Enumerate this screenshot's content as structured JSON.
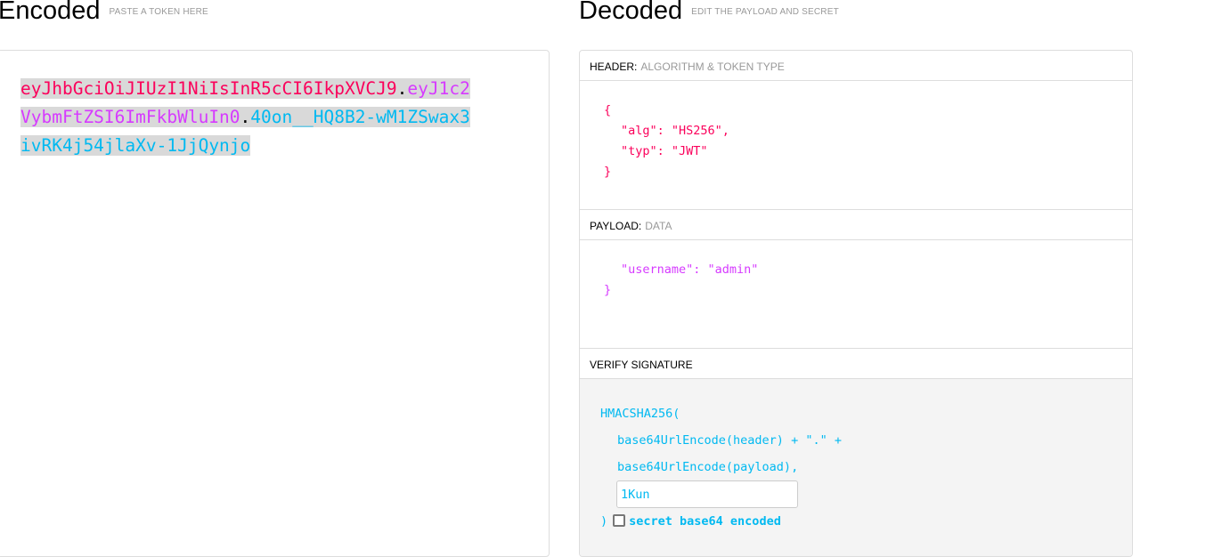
{
  "encoded": {
    "title": "Encoded",
    "subtitle": "PASTE A TOKEN HERE",
    "token": {
      "header": "eyJhbGciOiJIUzI1NiIsInR5cCI6IkpXVCJ9",
      "payload": "eyJ1c2VybmFtZSI6ImFkbWluIn0",
      "signature": "40on__HQ8B2-wM1ZSwax3ivRK4j54jlaXv-1JjQynjo",
      "dot": "."
    }
  },
  "decoded": {
    "title": "Decoded",
    "subtitle": "EDIT THE PAYLOAD AND SECRET",
    "header": {
      "label": "HEADER:",
      "sublabel": "ALGORITHM & TOKEN TYPE",
      "lines": [
        "{",
        "\"alg\": \"HS256\",",
        "\"typ\": \"JWT\"",
        "}"
      ]
    },
    "payload": {
      "label": "PAYLOAD:",
      "sublabel": "DATA",
      "lines": [
        "\"username\": \"admin\"",
        "}"
      ]
    },
    "signature": {
      "label": "VERIFY SIGNATURE",
      "fn": "HMACSHA256(",
      "line1": "base64UrlEncode(header) + \".\" +",
      "line2": "base64UrlEncode(payload),",
      "secret": "1Kun",
      "close": ")",
      "checkbox_label": "secret base64 encoded",
      "checked": false
    }
  },
  "colors": {
    "header": "#fb015b",
    "payload": "#d63aff",
    "signature": "#00b9f1"
  }
}
